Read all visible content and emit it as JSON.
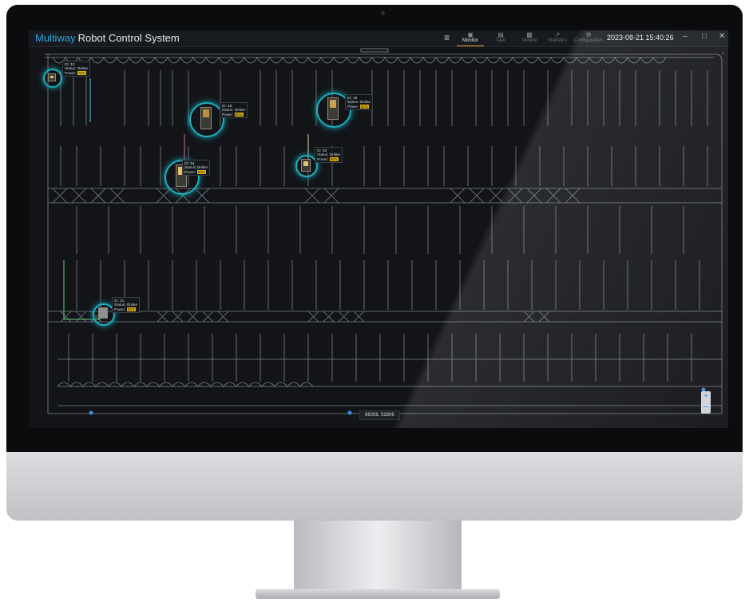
{
  "app": {
    "brand": "Multiway",
    "title": "Robot Control System",
    "datetime": "2023-08-21 15:40:26"
  },
  "nav": {
    "items": [
      {
        "label": "Monitor",
        "icon": "monitor-icon",
        "active": true
      },
      {
        "label": "Task",
        "icon": "task-icon",
        "active": false
      },
      {
        "label": "Vehicle",
        "icon": "vehicle-icon",
        "active": false
      },
      {
        "label": "Statistics",
        "icon": "statistics-icon",
        "active": false
      },
      {
        "label": "Configuration",
        "icon": "configuration-icon",
        "active": false
      }
    ]
  },
  "map": {
    "cursor_coords": "66056, 53806",
    "zoom_in": "+",
    "zoom_out": "−"
  },
  "robot_labels": {
    "id": "ID:",
    "status": "Status:",
    "power": "Power:"
  },
  "robots": [
    {
      "id": "13",
      "status": "Online",
      "power": "70%"
    },
    {
      "id": "15",
      "status": "Online",
      "power": "80%"
    },
    {
      "id": "16",
      "status": "Online",
      "power": "60%"
    },
    {
      "id": "14",
      "status": "Online",
      "power": "60%"
    },
    {
      "id": "20",
      "status": "Online",
      "power": "60%"
    },
    {
      "id": "21",
      "status": "Online",
      "power": "60%"
    }
  ],
  "colors": {
    "brand": "#2fa3e0",
    "ring": "#19b3c2",
    "active_tab": "#e3a72f",
    "power_badge": "#e0b400",
    "track": "#7d8289"
  }
}
